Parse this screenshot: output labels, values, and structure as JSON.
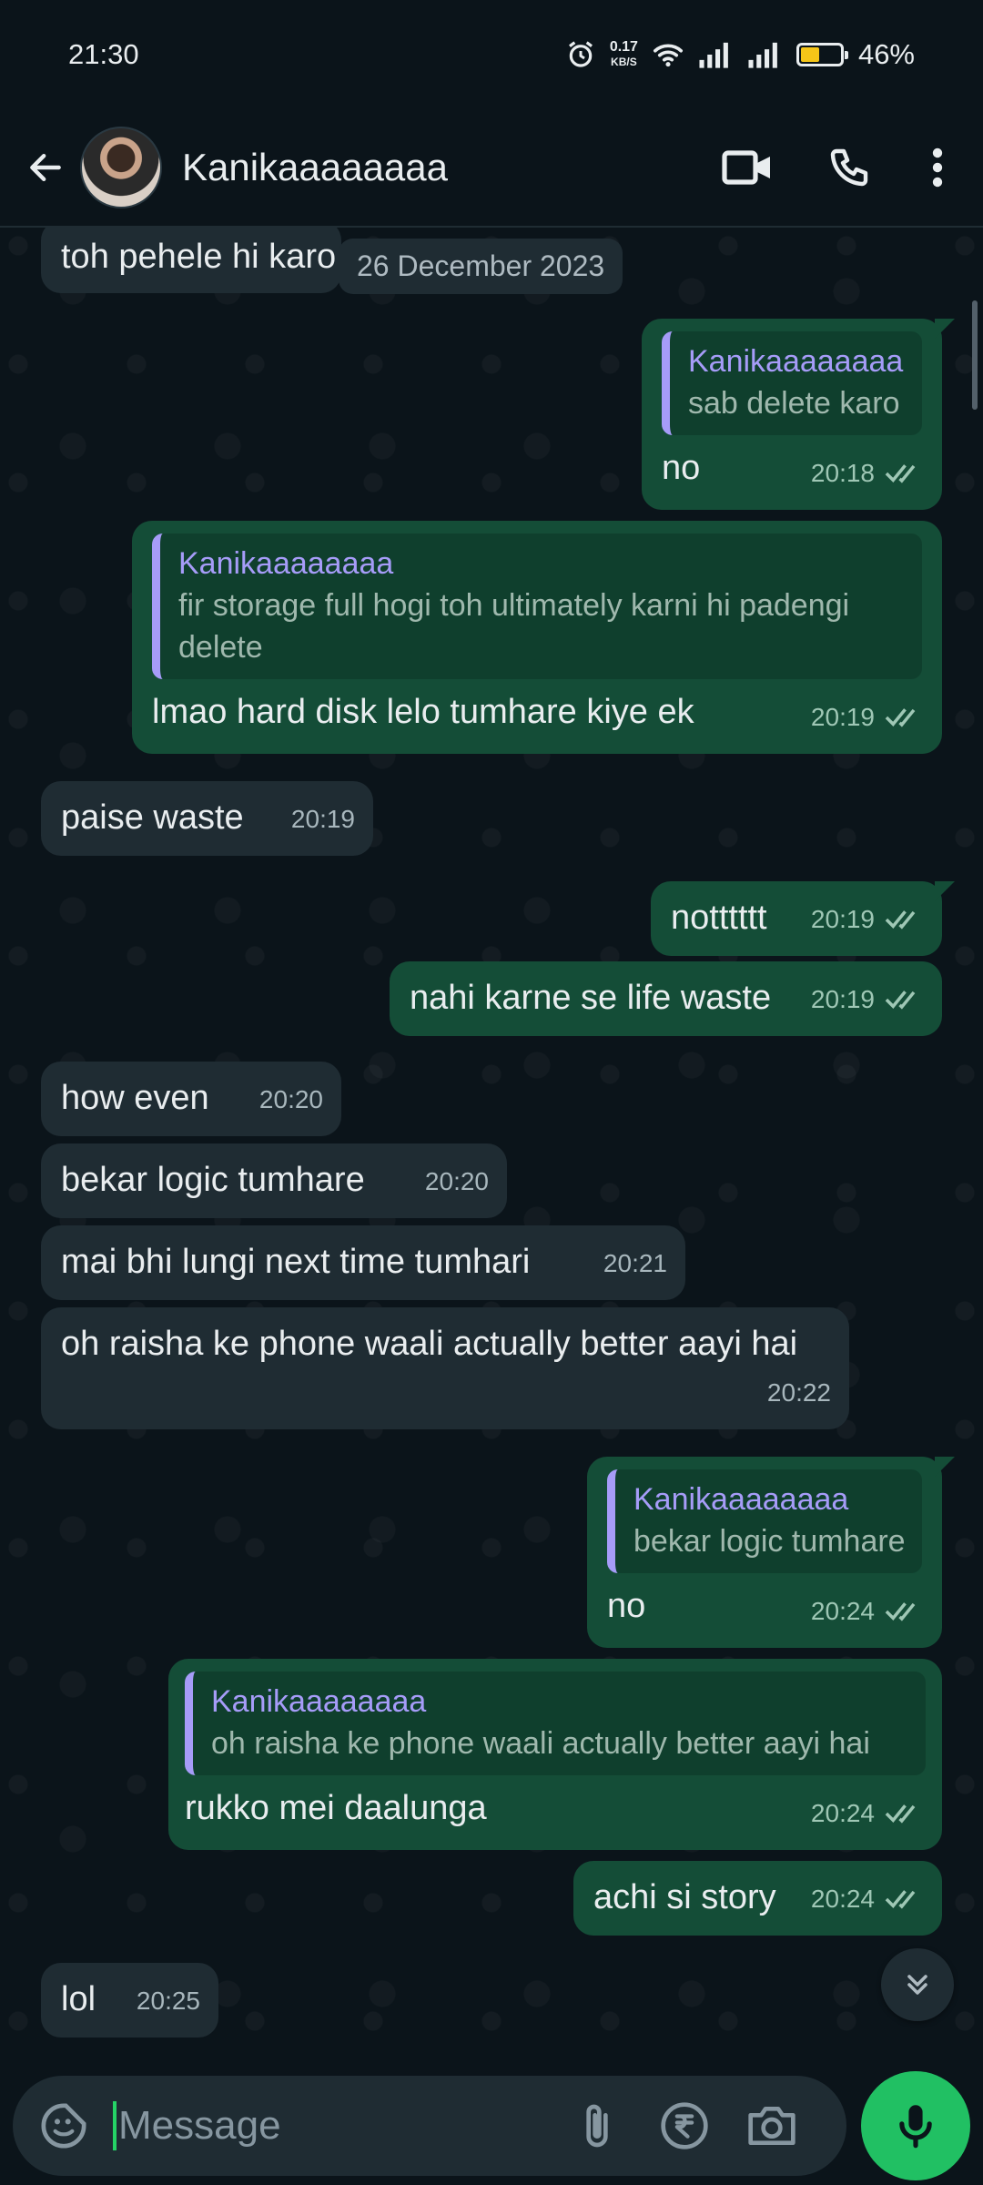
{
  "status_bar": {
    "time": "21:30",
    "net_speed_top": "0.17",
    "net_speed_bottom": "KB/S",
    "battery_percent": "46%",
    "battery_level": 0.46
  },
  "header": {
    "contact_name": "Kanikaaaaaaaa",
    "icons": [
      "back-arrow-icon",
      "video-call-icon",
      "phone-icon",
      "more-options-icon"
    ]
  },
  "chat": {
    "date_chip": "26 December 2023",
    "partial_top_message": "toh pehele hi karo",
    "messages": [
      {
        "dir": "out",
        "quote_name": "Kanikaaaaaaaa",
        "quote_text": "sab delete karo",
        "text": "no",
        "time": "20:18"
      },
      {
        "dir": "out",
        "quote_name": "Kanikaaaaaaaa",
        "quote_text": "fir storage full hogi toh ultimately karni hi padengi delete",
        "text": "lmao hard disk lelo tumhare kiye ek",
        "time": "20:19"
      },
      {
        "dir": "in",
        "text": "paise waste",
        "time": "20:19"
      },
      {
        "dir": "out",
        "text": "notttttt",
        "time": "20:19"
      },
      {
        "dir": "out",
        "text": "nahi karne se life waste",
        "time": "20:19"
      },
      {
        "dir": "in",
        "text": "how even",
        "time": "20:20"
      },
      {
        "dir": "in",
        "text": "bekar logic tumhare",
        "time": "20:20"
      },
      {
        "dir": "in",
        "text": "mai bhi lungi next time tumhari",
        "time": "20:21"
      },
      {
        "dir": "in",
        "text": "oh raisha ke phone waali actually better aayi hai",
        "time": "20:22"
      },
      {
        "dir": "out",
        "quote_name": "Kanikaaaaaaaa",
        "quote_text": "bekar logic tumhare",
        "text": "no",
        "time": "20:24"
      },
      {
        "dir": "out",
        "quote_name": "Kanikaaaaaaaa",
        "quote_text": "oh raisha ke phone waali actually better aayi hai",
        "text": "rukko mei daalunga",
        "time": "20:24"
      },
      {
        "dir": "out",
        "text": "achi si story",
        "time": "20:24"
      },
      {
        "dir": "in",
        "text": "lol",
        "time": "20:25"
      }
    ]
  },
  "input": {
    "placeholder": "Message"
  },
  "colors": {
    "background": "#0b141a",
    "incoming_bubble": "#1f2c33",
    "outgoing_bubble": "#144d37",
    "quote_accent": "#a69cf8",
    "mic_button": "#21c063"
  }
}
